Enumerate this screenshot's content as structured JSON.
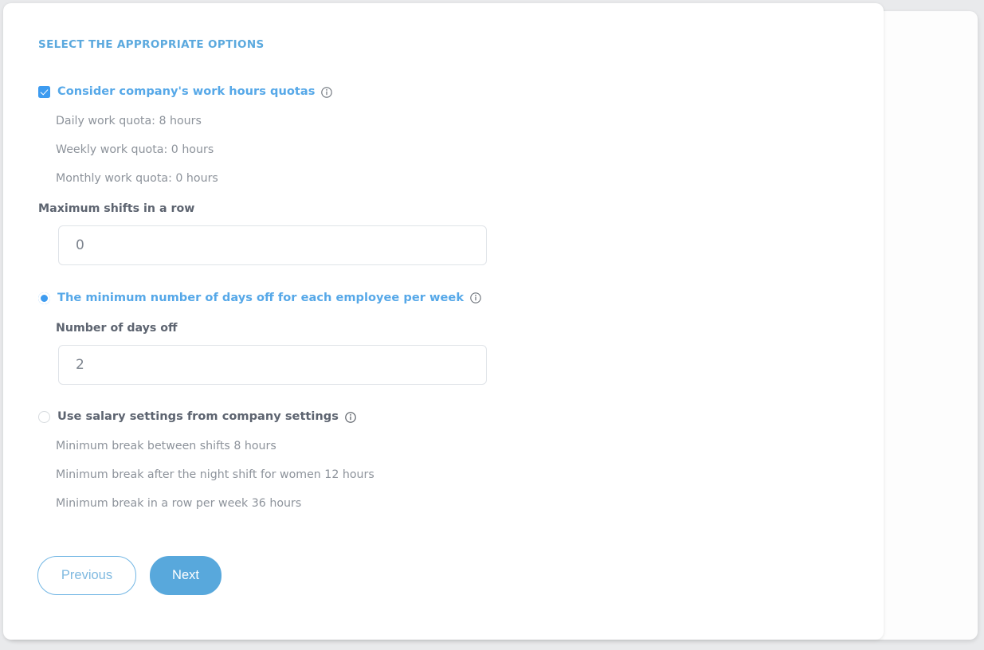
{
  "section": {
    "title": "Select the appropriate options"
  },
  "options": {
    "work_hours_quotas": {
      "label": "Consider company's work hours quotas",
      "checked": true,
      "info_icon": "info-icon",
      "details": [
        "Daily work quota: 8 hours",
        "Weekly work quota: 0 hours",
        "Monthly work quota: 0 hours"
      ],
      "max_shifts_field": {
        "label": "Maximum shifts in a row",
        "value": "0"
      }
    },
    "min_days_off": {
      "label": "The minimum number of days off for each employee per week",
      "selected": true,
      "info_icon": "info-icon",
      "days_off_field": {
        "label": "Number of days off",
        "value": "2"
      }
    },
    "salary_settings": {
      "label": "Use salary settings from company settings",
      "selected": false,
      "info_icon": "info-icon",
      "details": [
        "Minimum break between shifts 8 hours",
        "Minimum break after the night shift for women 12 hours",
        "Minimum break in a row per week 36 hours"
      ]
    }
  },
  "footer": {
    "previous_label": "Previous",
    "next_label": "Next"
  },
  "colors": {
    "accent_blue": "#56a8e8",
    "heading_blue": "#5ba9de",
    "next_button_blue": "#58a8dc",
    "muted_text": "#8d939b",
    "label_text": "#5d6470"
  }
}
